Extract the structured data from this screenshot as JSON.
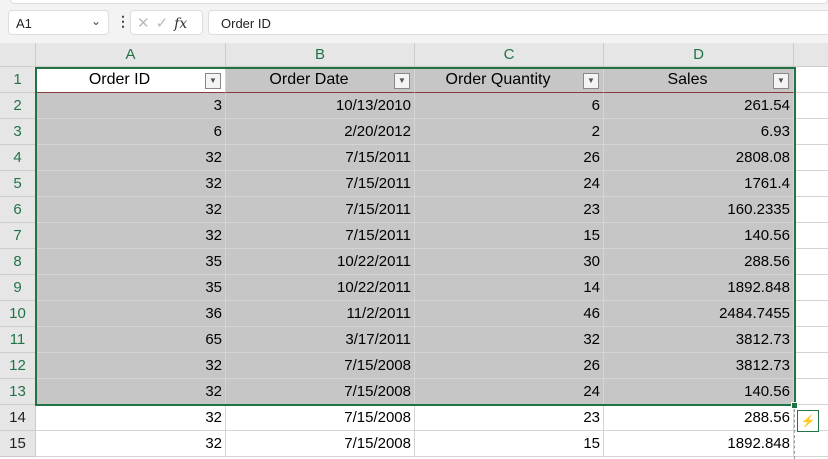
{
  "formula_bar": {
    "name_box": "A1",
    "formula": "Order ID",
    "fx": "fx",
    "cancel": "✕",
    "enter": "✓"
  },
  "columns": [
    "A",
    "B",
    "C",
    "D"
  ],
  "headers": [
    "Order ID",
    "Order Date",
    "Order Quantity",
    "Sales"
  ],
  "rows": [
    [
      "3",
      "10/13/2010",
      "6",
      "261.54"
    ],
    [
      "6",
      "2/20/2012",
      "2",
      "6.93"
    ],
    [
      "32",
      "7/15/2011",
      "26",
      "2808.08"
    ],
    [
      "32",
      "7/15/2011",
      "24",
      "1761.4"
    ],
    [
      "32",
      "7/15/2011",
      "23",
      "160.2335"
    ],
    [
      "32",
      "7/15/2011",
      "15",
      "140.56"
    ],
    [
      "35",
      "10/22/2011",
      "30",
      "288.56"
    ],
    [
      "35",
      "10/22/2011",
      "14",
      "1892.848"
    ],
    [
      "36",
      "11/2/2011",
      "46",
      "2484.7455"
    ],
    [
      "65",
      "3/17/2011",
      "32",
      "3812.73"
    ],
    [
      "32",
      "7/15/2008",
      "26",
      "3812.73"
    ],
    [
      "32",
      "7/15/2008",
      "24",
      "140.56"
    ],
    [
      "32",
      "7/15/2008",
      "23",
      "288.56"
    ],
    [
      "32",
      "7/15/2008",
      "15",
      "1892.848"
    ]
  ],
  "row_numbers": [
    "1",
    "2",
    "3",
    "4",
    "5",
    "6",
    "7",
    "8",
    "9",
    "10",
    "11",
    "12",
    "13",
    "14",
    "15"
  ],
  "colors": {
    "accent": "#217346",
    "selection": "#c6c6c6"
  }
}
